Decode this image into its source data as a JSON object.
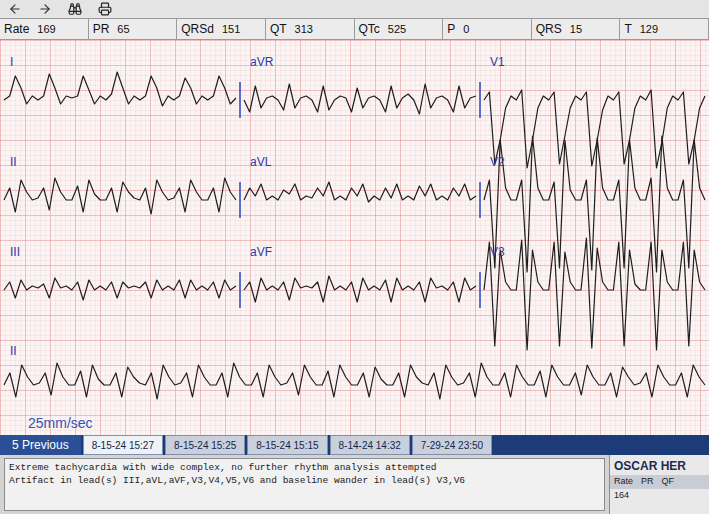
{
  "measurements": [
    {
      "label": "Rate",
      "value": "169"
    },
    {
      "label": "PR",
      "value": "65"
    },
    {
      "label": "QRSd",
      "value": "151"
    },
    {
      "label": "QT",
      "value": "313"
    },
    {
      "label": "QTc",
      "value": "525"
    },
    {
      "label": "P",
      "value": "0"
    },
    {
      "label": "QRS",
      "value": "15"
    },
    {
      "label": "T",
      "value": "129"
    }
  ],
  "ecg": {
    "speed": "25mm/sec",
    "rows": [
      {
        "leads": [
          {
            "name": "I",
            "values": [
              0,
              0.1,
              0.6,
              0.3,
              -0.1,
              0.1,
              0,
              0.1,
              0.65,
              0.3,
              -0.1,
              0.1,
              0.05,
              0.1,
              0.6,
              0.25,
              -0.1,
              0.1,
              0,
              0.15,
              0.7,
              0.3,
              -0.1,
              0.1,
              0,
              0.1,
              0.6,
              0.3,
              -0.15,
              0.1,
              0,
              0.1,
              0.55,
              0.3,
              -0.1,
              0.1,
              0,
              0.1,
              0.6,
              0.3,
              -0.1,
              0.05
            ]
          },
          {
            "name": "aVR",
            "values": [
              0,
              -0.3,
              0.35,
              -0.2,
              0.05,
              0.1,
              0,
              -0.25,
              0.4,
              -0.2,
              0.05,
              0.1,
              0,
              -0.3,
              0.35,
              -0.25,
              0,
              0.1,
              0.05,
              -0.3,
              0.3,
              -0.2,
              0.05,
              0.1,
              0,
              -0.3,
              0.35,
              -0.2,
              0.05,
              0.15,
              0,
              -0.35,
              0.4,
              -0.2,
              0.05,
              0.1,
              0,
              -0.3,
              0.35,
              -0.2,
              0.05,
              0.1
            ]
          },
          {
            "name": "V1",
            "values": [
              0,
              0.2,
              -1.6,
              -1.0,
              -0.2,
              0.1,
              0,
              0.25,
              -1.7,
              -1.0,
              -0.2,
              0.1,
              0,
              0.2,
              -1.6,
              -0.9,
              -0.2,
              0.1,
              0,
              0.2,
              -1.65,
              -1.0,
              -0.25,
              0.1,
              0,
              0.2,
              -1.6,
              -1.0,
              -0.2,
              0.1,
              0,
              0.25,
              -1.7,
              -1.05,
              -0.2,
              0.1,
              0,
              0.2,
              -1.6,
              -1.0,
              -0.2,
              0.1
            ]
          }
        ]
      },
      {
        "leads": [
          {
            "name": "II",
            "values": [
              0,
              0.3,
              -0.3,
              0.5,
              0.2,
              0,
              0.05,
              0.3,
              -0.25,
              0.55,
              0.2,
              0,
              0,
              0.35,
              -0.3,
              0.5,
              0.15,
              0,
              0,
              0.3,
              -0.3,
              0.45,
              0.2,
              0.05,
              0,
              0.3,
              -0.35,
              0.5,
              0.2,
              0,
              0.05,
              0.3,
              -0.3,
              0.5,
              0.2,
              0,
              0,
              0.3,
              -0.3,
              0.55,
              0.2,
              0
            ]
          },
          {
            "name": "aVL",
            "values": [
              0,
              0.3,
              0.1,
              0.4,
              0,
              0.1,
              0,
              0.25,
              0.15,
              0.4,
              0,
              0.1,
              0.05,
              0.3,
              0.1,
              0.45,
              0,
              0.1,
              0,
              0.3,
              0.1,
              0.4,
              -0.05,
              0.1,
              0,
              0.3,
              0.05,
              0.4,
              0,
              0.1,
              0,
              0.35,
              0.1,
              0.4,
              0,
              0.1,
              0,
              0.3,
              0.1,
              0.4,
              0,
              0.1
            ]
          },
          {
            "name": "V2",
            "values": [
              0,
              0.5,
              -1.7,
              1.5,
              0.3,
              0,
              0,
              0.5,
              -1.8,
              1.6,
              0.3,
              0,
              0,
              0.45,
              -1.7,
              1.5,
              0.25,
              0,
              0,
              0.5,
              -1.75,
              1.55,
              0.3,
              0,
              0,
              0.5,
              -1.7,
              1.5,
              0.3,
              0,
              0,
              0.55,
              -1.8,
              1.6,
              0.3,
              0,
              0,
              0.5,
              -1.7,
              1.5,
              0.3,
              0
            ]
          }
        ]
      },
      {
        "leads": [
          {
            "name": "III",
            "values": [
              0,
              0.2,
              -0.2,
              0.25,
              0,
              0.1,
              0.05,
              0.15,
              -0.2,
              0.3,
              0.05,
              0.1,
              0,
              0.2,
              -0.25,
              0.25,
              0,
              0.1,
              0,
              0.2,
              -0.2,
              0.2,
              0.05,
              0.1,
              0.05,
              0.2,
              -0.2,
              0.25,
              0,
              0.1,
              0,
              0.25,
              -0.2,
              0.25,
              0,
              0.1,
              0,
              0.2,
              -0.2,
              0.25,
              0,
              0.1
            ]
          },
          {
            "name": "aVF",
            "values": [
              0,
              0.2,
              -0.3,
              0.3,
              0,
              0.1,
              0,
              0.2,
              -0.25,
              0.3,
              0.05,
              0.1,
              0.05,
              0.2,
              -0.3,
              0.35,
              0,
              0.1,
              0,
              0.2,
              -0.3,
              0.3,
              0,
              0.1,
              0,
              0.25,
              -0.3,
              0.3,
              0,
              0.1,
              0,
              0.2,
              -0.3,
              0.3,
              0.05,
              0.1,
              0,
              0.2,
              -0.3,
              0.3,
              0,
              0.1
            ]
          },
          {
            "name": "V3",
            "values": [
              0,
              1.2,
              -1.4,
              1.0,
              0.2,
              0,
              0,
              1.25,
              -1.5,
              1.0,
              0.2,
              0,
              0,
              1.2,
              -1.4,
              0.95,
              0.2,
              0,
              0,
              1.3,
              -1.45,
              1.05,
              0.2,
              0,
              0,
              1.2,
              -1.4,
              1.0,
              0.15,
              0,
              0,
              1.2,
              -1.5,
              1.0,
              0.2,
              0,
              0,
              1.2,
              -1.4,
              1.0,
              0.2,
              0
            ]
          }
        ]
      }
    ],
    "rhythm": {
      "name": "II",
      "values": [
        0,
        0.3,
        -0.3,
        0.5,
        0.2,
        0,
        0.05,
        0.3,
        -0.25,
        0.55,
        0.2,
        0,
        0,
        0.35,
        -0.3,
        0.5,
        0.15,
        0,
        0,
        0.3,
        -0.3,
        0.45,
        0.2,
        0.05,
        0,
        0.3,
        -0.35,
        0.5,
        0.2,
        0,
        0.05,
        0.3,
        -0.3,
        0.5,
        0.2,
        0,
        0,
        0.3,
        -0.3,
        0.55,
        0.2,
        0,
        0,
        0.3,
        -0.3,
        0.5,
        0.2,
        0,
        0.05,
        0.3,
        -0.25,
        0.5,
        0.2,
        0,
        0,
        0.35,
        -0.3,
        0.5,
        0.2,
        0,
        0,
        0.3,
        -0.3,
        0.45,
        0.15,
        0,
        0,
        0.3,
        -0.3,
        0.5,
        0.2,
        0.05,
        0,
        0.3,
        -0.35,
        0.5,
        0.2,
        0,
        0.05,
        0.3,
        -0.3,
        0.55,
        0.2,
        0,
        0,
        0.3,
        -0.3,
        0.5,
        0.2,
        0,
        0,
        0.35,
        -0.3,
        0.5,
        0.2,
        0,
        0,
        0.3,
        -0.25,
        0.5,
        0.2,
        0,
        0,
        0.3,
        -0.3,
        0.45,
        0.2,
        0,
        0.05,
        0.3,
        -0.3,
        0.5,
        0.2,
        0,
        0,
        0.3,
        -0.3,
        0.5,
        0.2,
        0
      ]
    }
  },
  "history": {
    "label": "5 Previous",
    "tabs": [
      {
        "label": "8-15-24 15:27",
        "selected": true
      },
      {
        "label": "8-15-24 15:25",
        "selected": false
      },
      {
        "label": "8-15-24 15:15",
        "selected": false
      },
      {
        "label": "8-14-24 14:32",
        "selected": false
      },
      {
        "label": "7-29-24 23:50",
        "selected": false
      }
    ]
  },
  "interpretation": [
    "Extreme tachycardia with wide complex, no further rhythm analysis attempted",
    "Artifact in lead(s) III,aVL,aVF,V3,V4,V5,V6 and baseline wander in lead(s) V3,V6"
  ],
  "patient_panel": {
    "name": "OSCAR HER",
    "columns": [
      "Rate",
      "PR",
      "QF"
    ],
    "values": [
      "164"
    ]
  }
}
